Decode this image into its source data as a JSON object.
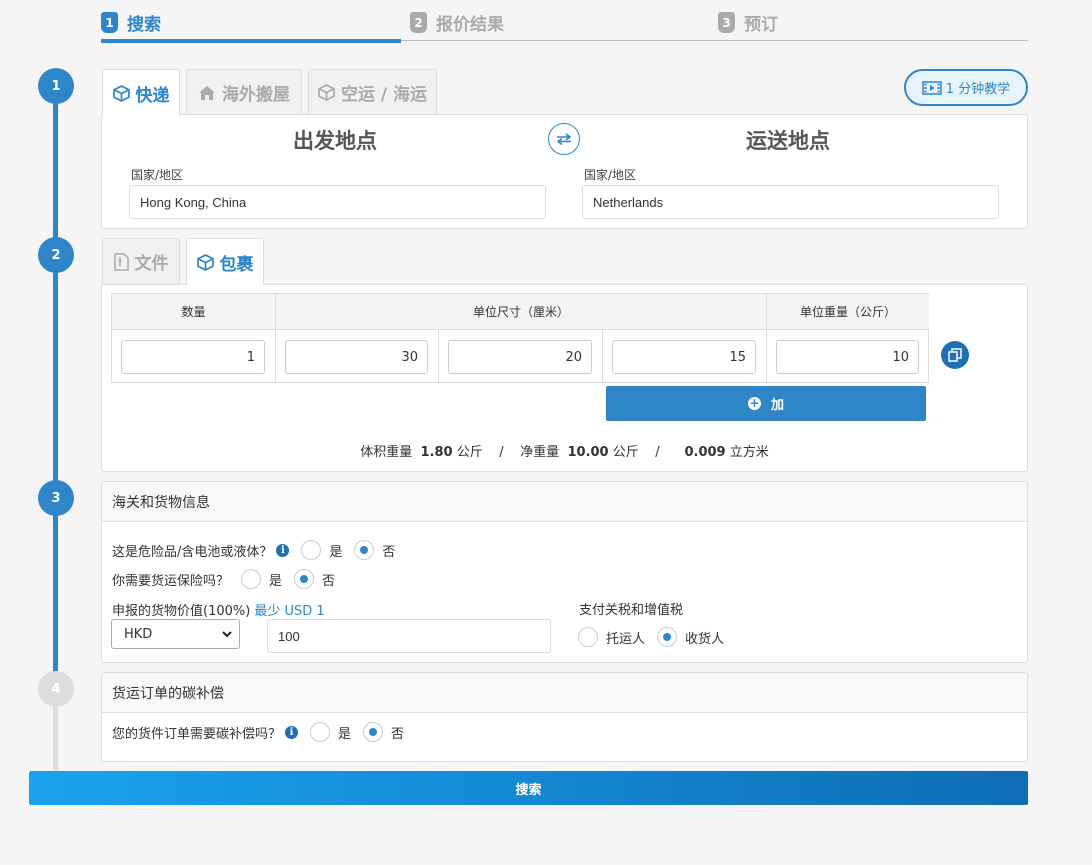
{
  "steps": [
    {
      "num": "1",
      "label": "搜索"
    },
    {
      "num": "2",
      "label": "报价结果"
    },
    {
      "num": "3",
      "label": "预订"
    }
  ],
  "timeline": [
    "1",
    "2",
    "3",
    "4"
  ],
  "shipping_tabs": [
    "快递",
    "海外搬屋",
    "空运 / 海运"
  ],
  "tutorial_label": "1 分钟教学",
  "origin": {
    "title": "出发地点",
    "country_label": "国家/地区",
    "country_value": "Hong Kong, China"
  },
  "destination": {
    "title": "运送地点",
    "country_label": "国家/地区",
    "country_value": "Netherlands"
  },
  "package_tabs": [
    "文件",
    "包裹"
  ],
  "package_table": {
    "headers": {
      "qty": "数量",
      "dims": "单位尺寸（厘米）",
      "weight": "单位重量（公斤）"
    },
    "row": {
      "qty": "1",
      "length": "30",
      "width": "20",
      "height": "15",
      "weight": "10"
    }
  },
  "add_label": "加",
  "summary": {
    "vol_label": "体积重量",
    "vol_value": "1.80",
    "vol_unit": "公斤",
    "sep1": "/",
    "net_label": "净重量",
    "net_value": "10.00",
    "net_unit": "公斤",
    "sep2": "/",
    "cbm_value": "0.009",
    "cbm_unit": "立方米"
  },
  "customs": {
    "title": "海关和货物信息",
    "dangerous_q": "这是危险品/含电池或液体？",
    "insurance_q": "你需要货运保险吗？",
    "yes": "是",
    "no": "否",
    "declared_label": "申报的货物价值(100%)",
    "declared_min": "最少 USD 1",
    "currency": "HKD",
    "declared_value": "100",
    "duties_label": "支付关税和增值税",
    "shipper": "托运人",
    "consignee": "收货人"
  },
  "carbon": {
    "title": "货运订单的碳补偿",
    "question": "您的货件订单需要碳补偿吗？",
    "yes": "是",
    "no": "否"
  },
  "search_label": "搜索"
}
